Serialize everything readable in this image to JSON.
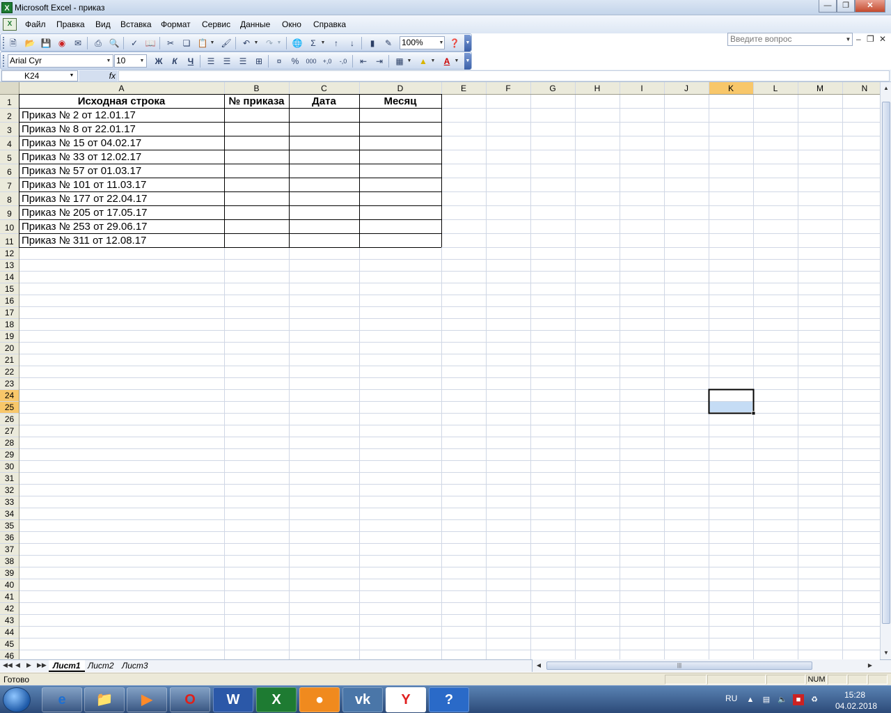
{
  "window": {
    "title": "Microsoft Excel - приказ",
    "app_icon": "X"
  },
  "menu": {
    "items": [
      "Файл",
      "Правка",
      "Вид",
      "Вставка",
      "Формат",
      "Сервис",
      "Данные",
      "Окно",
      "Справка"
    ],
    "help_placeholder": "Введите вопрос"
  },
  "toolbar": {
    "zoom": "100%",
    "font": "Arial Cyr",
    "font_size": "10"
  },
  "formula_bar": {
    "name_box": "K24",
    "fx": "fx",
    "value": ""
  },
  "grid": {
    "columns": [
      "A",
      "B",
      "C",
      "D",
      "E",
      "F",
      "G",
      "H",
      "I",
      "J",
      "K",
      "L",
      "M",
      "N"
    ],
    "active_column": "K",
    "active_rows": [
      24,
      25
    ],
    "row_count": 46,
    "headers": [
      "Исходная строка",
      "№ приказа",
      "Дата",
      "Месяц"
    ],
    "rows": [
      "Приказ № 2  от 12.01.17",
      "Приказ № 8  от 22.01.17",
      "Приказ № 15 от 04.02.17",
      "Приказ № 33 от 12.02.17",
      "Приказ № 57 от 01.03.17",
      "Приказ № 101 от 11.03.17",
      "Приказ № 177 от 22.04.17",
      "Приказ № 205 от 17.05.17",
      "Приказ № 253 от 29.06.17",
      "Приказ № 311 от 12.08.17"
    ]
  },
  "sheets": {
    "tabs": [
      "Лист1",
      "Лист2",
      "Лист3"
    ],
    "active": 0
  },
  "status": {
    "text": "Готово",
    "num": "NUM"
  },
  "taskbar": {
    "lang": "RU",
    "time": "15:28",
    "date": "04.02.2018"
  },
  "colors": {
    "active_header": "#f8c76a",
    "selection": "#c5dcf5",
    "header_bg": "#ebeadb"
  }
}
